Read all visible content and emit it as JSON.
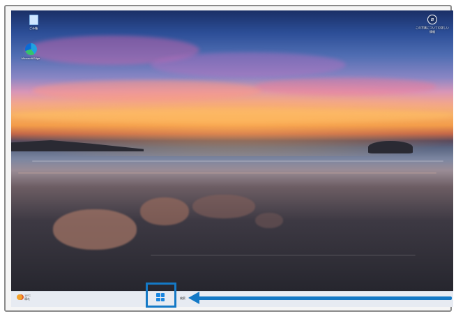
{
  "desktop": {
    "icons": [
      {
        "label": "ごみ箱",
        "icon": "recycle-bin-icon"
      },
      {
        "label": "Microsoft Edge",
        "icon": "edge-icon"
      }
    ],
    "info_widget": {
      "label": "この写真についての詳しい情報",
      "icon": "camera-info-icon"
    }
  },
  "taskbar": {
    "weather": {
      "temp": "19°C",
      "condition": "晴れ"
    },
    "start_icon": "windows-start-icon",
    "search_label": "検索"
  },
  "annotation": {
    "highlight_color": "#1479c6"
  }
}
